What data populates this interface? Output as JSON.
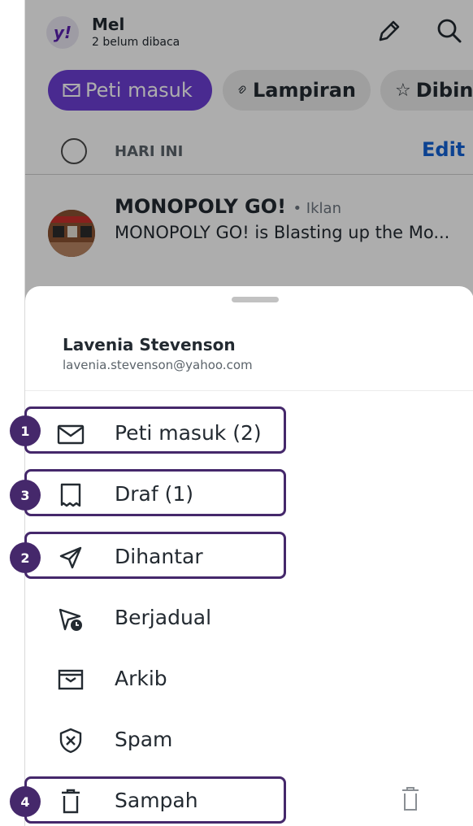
{
  "header": {
    "logo": "y!",
    "title": "Mel",
    "subtitle": "2 belum dibaca",
    "compose_icon": "pencil-icon",
    "search_icon": "search-icon"
  },
  "chips": [
    {
      "label": "Peti masuk",
      "icon": "envelope-icon",
      "active": true
    },
    {
      "label": "Lampiran",
      "icon": "paperclip-icon",
      "active": false
    },
    {
      "label": "Dibint",
      "icon": "star-icon",
      "active": false
    }
  ],
  "section": {
    "label": "HARI INI",
    "edit": "Edit"
  },
  "ad": {
    "sender": "MONOPOLY GO!",
    "tag": "• Iklan",
    "preview": "MONOPOLY GO! is Blasting up the Mo..."
  },
  "account": {
    "name": "Lavenia Stevenson",
    "email": "lavenia.stevenson@yahoo.com"
  },
  "folders": [
    {
      "label": "Peti masuk (2)",
      "icon": "inbox-icon"
    },
    {
      "label": "Draf (1)",
      "icon": "draft-icon"
    },
    {
      "label": "Dihantar",
      "icon": "send-icon"
    },
    {
      "label": "Berjadual",
      "icon": "scheduled-icon"
    },
    {
      "label": "Arkib",
      "icon": "archive-icon"
    },
    {
      "label": "Spam",
      "icon": "spam-shield-icon"
    },
    {
      "label": "Sampah",
      "icon": "trash-icon"
    }
  ],
  "annotations": [
    "1",
    "3",
    "2",
    "4"
  ],
  "colors": {
    "accent": "#6c3fd4",
    "link": "#1262d6",
    "highlight": "#45286b"
  }
}
